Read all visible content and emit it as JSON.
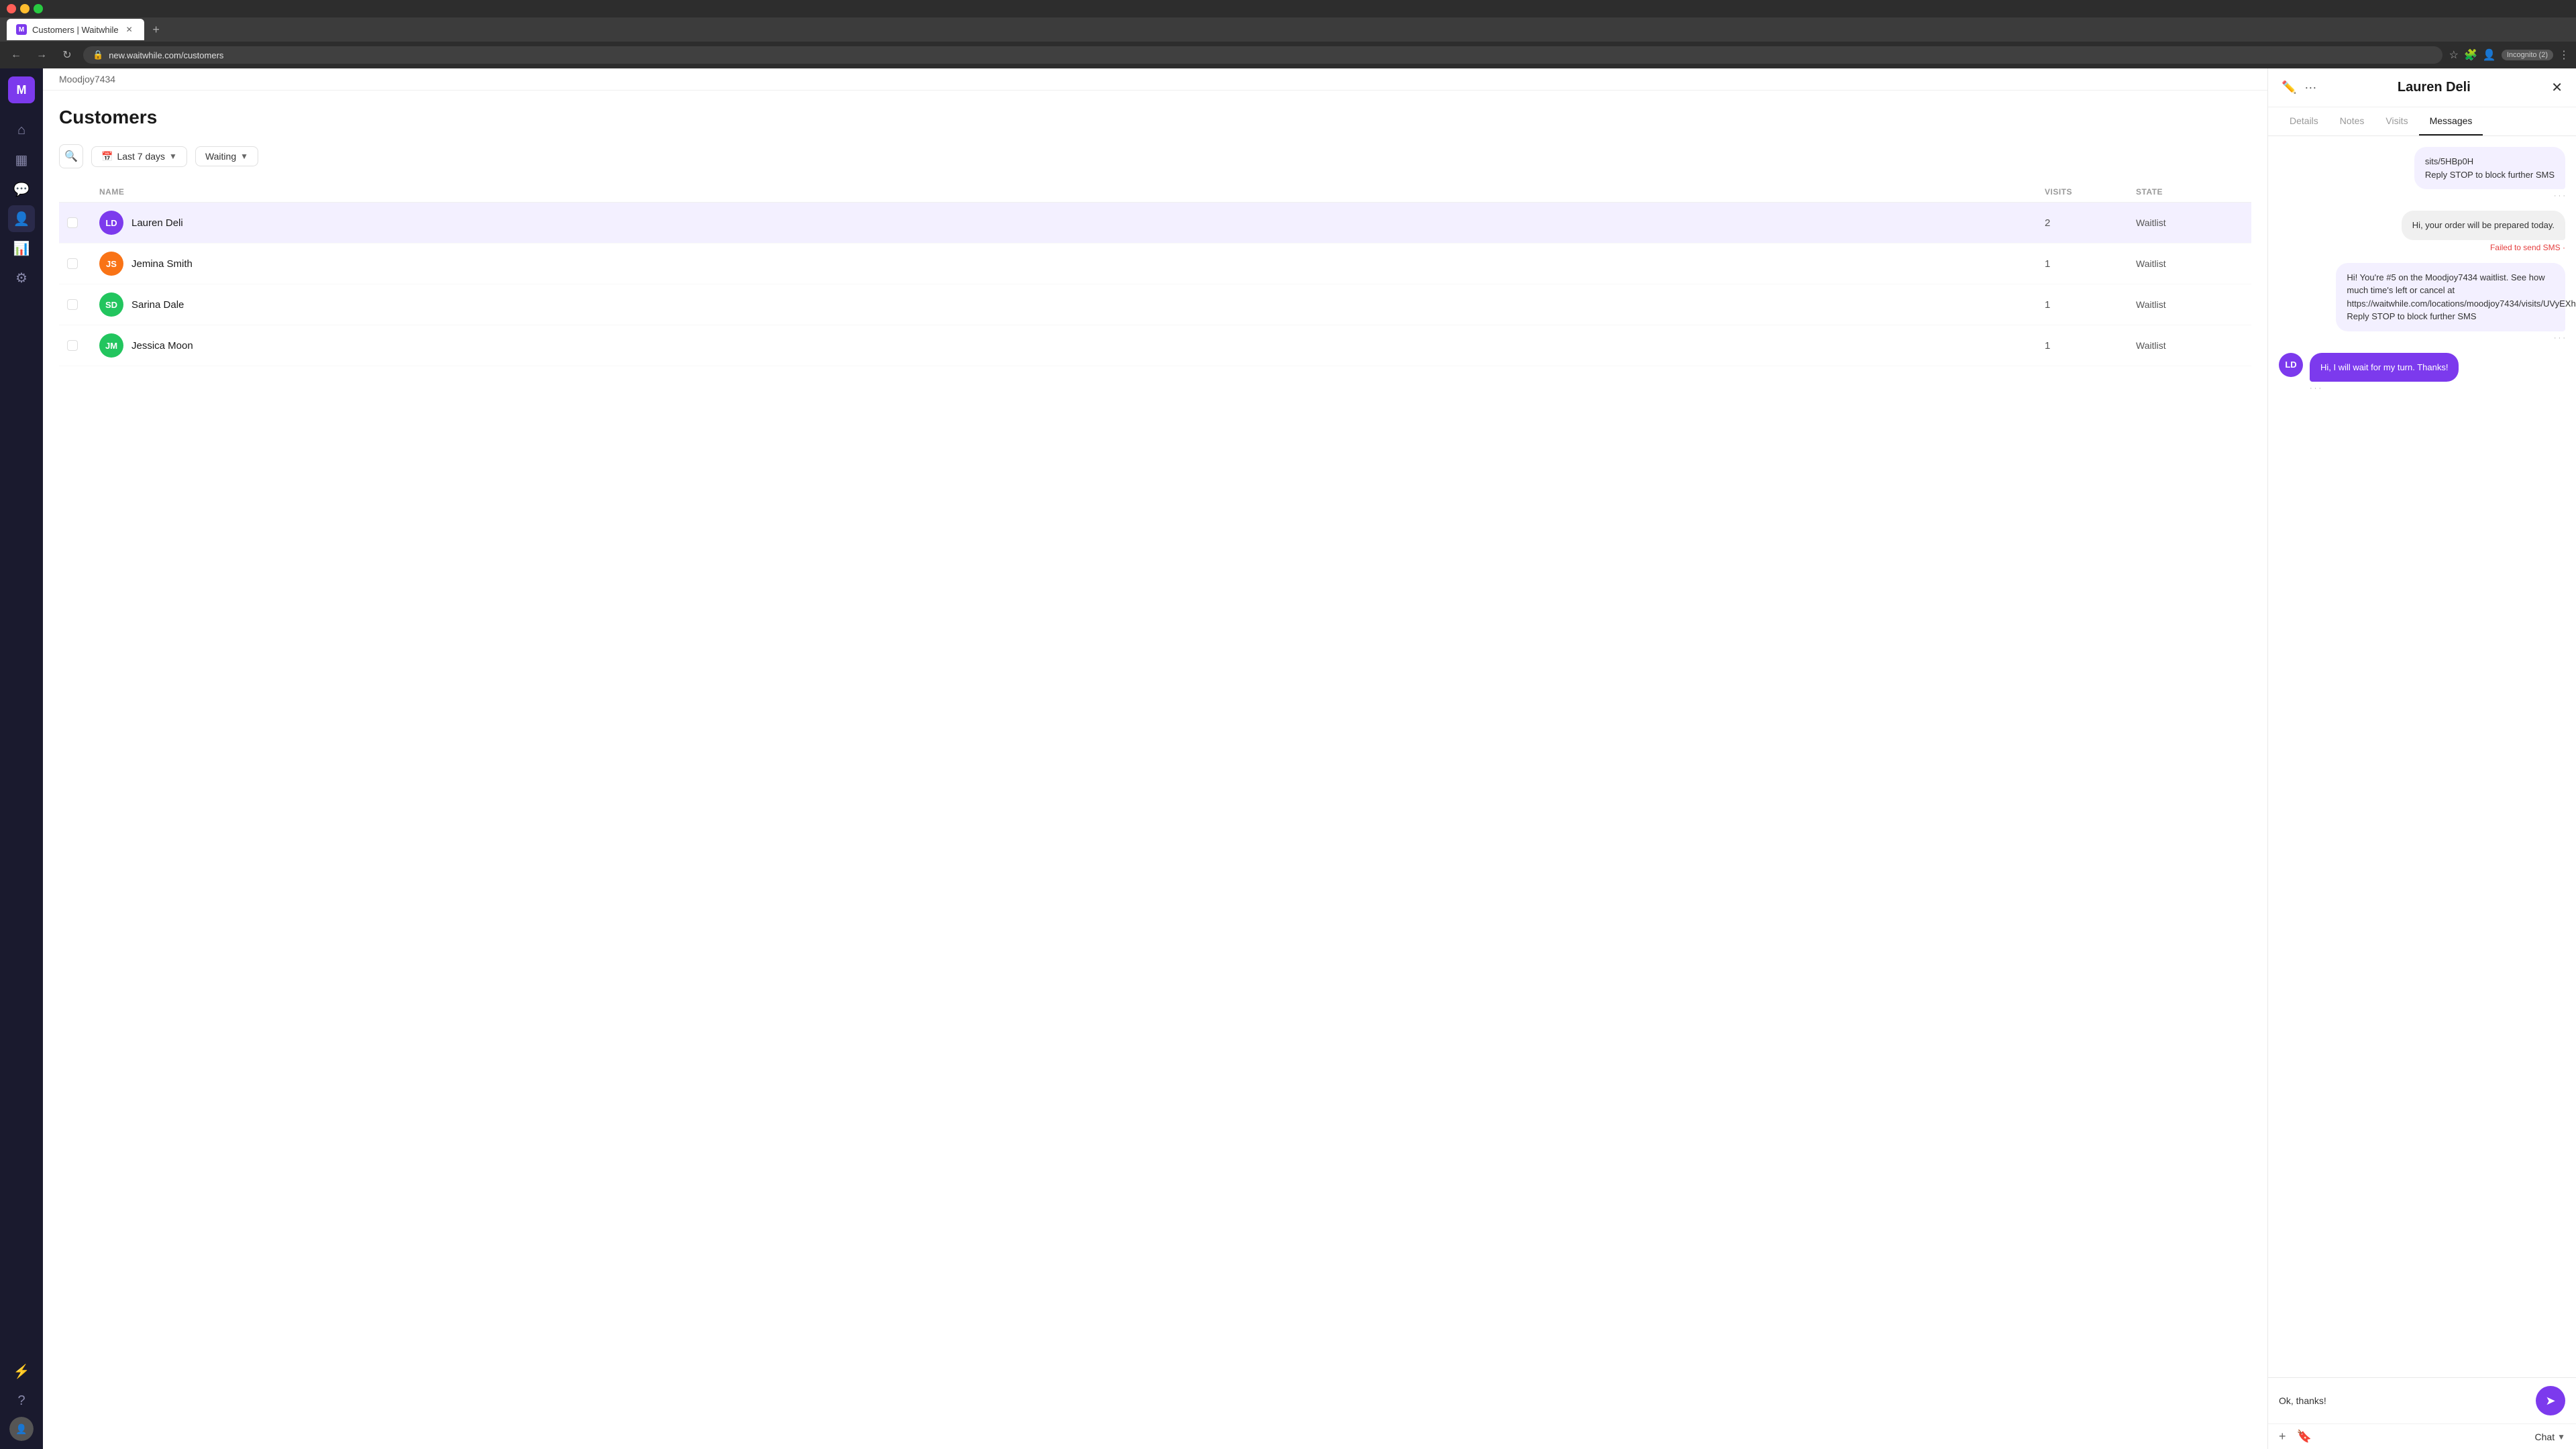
{
  "browser": {
    "tab_title": "Customers | Waitwhile",
    "url": "new.waitwhile.com/customers",
    "incognito_label": "Incognito (2)"
  },
  "sidebar": {
    "logo_letter": "M",
    "items": [
      {
        "id": "home",
        "icon": "⌂",
        "active": false
      },
      {
        "id": "calendar",
        "icon": "▦",
        "active": false
      },
      {
        "id": "chat",
        "icon": "💬",
        "active": false
      },
      {
        "id": "customers",
        "icon": "👤",
        "active": true
      },
      {
        "id": "analytics",
        "icon": "📊",
        "active": false
      },
      {
        "id": "settings",
        "icon": "⚙",
        "active": false
      }
    ],
    "bottom_items": [
      {
        "id": "lightning",
        "icon": "⚡"
      },
      {
        "id": "help",
        "icon": "?"
      }
    ]
  },
  "main": {
    "location": "Moodjoy7434",
    "page_title": "Customers",
    "filters": {
      "date_range": "Last 7 days",
      "status": "Waiting"
    },
    "table": {
      "columns": [
        "",
        "NAME",
        "VISITS",
        "STATE"
      ],
      "rows": [
        {
          "id": "lauren-deli",
          "initials": "LD",
          "name": "Lauren Deli",
          "visits": 2,
          "state": "Waitlist",
          "avatar_color": "#7c3aed",
          "selected": true
        },
        {
          "id": "jemina-smith",
          "initials": "JS",
          "name": "Jemina Smith",
          "visits": 1,
          "state": "Waitlist",
          "avatar_color": "#f97316",
          "selected": false
        },
        {
          "id": "sarina-dale",
          "initials": "SD",
          "name": "Sarina Dale",
          "visits": 1,
          "state": "Waitlist",
          "avatar_color": "#22c55e",
          "selected": false
        },
        {
          "id": "jessica-moon",
          "initials": "JM",
          "name": "Jessica Moon",
          "visits": 1,
          "state": "Waitlist",
          "avatar_color": "#22c55e",
          "selected": false
        }
      ]
    }
  },
  "panel": {
    "title": "Lauren Deli",
    "tabs": [
      "Details",
      "Notes",
      "Visits",
      "Messages"
    ],
    "active_tab": "Messages",
    "messages": [
      {
        "type": "outbound",
        "text": "sits/5HBp0H\nReply STOP to block further SMS",
        "failed": false
      },
      {
        "type": "sent",
        "text": "Hi, your order will be prepared today.",
        "failed": true,
        "failed_label": "Failed to send SMS ·"
      },
      {
        "type": "outbound",
        "text": "Hi! You're #5 on the Moodjoy7434 waitlist. See how much time's left or cancel at https://waitwhile.com/locations/moodjoy7434/visits/UVyEXh\nReply STOP to block further SMS",
        "failed": false
      },
      {
        "type": "received",
        "sender_initials": "LD",
        "sender_color": "#7c3aed",
        "text": "Hi, I will wait for my turn. Thanks!",
        "failed": false
      }
    ],
    "input_placeholder": "Ok, thanks!",
    "input_value": "Ok, thanks!",
    "toolbar": {
      "add_label": "+",
      "bookmark_label": "🔖",
      "chat_label": "Chat"
    }
  }
}
